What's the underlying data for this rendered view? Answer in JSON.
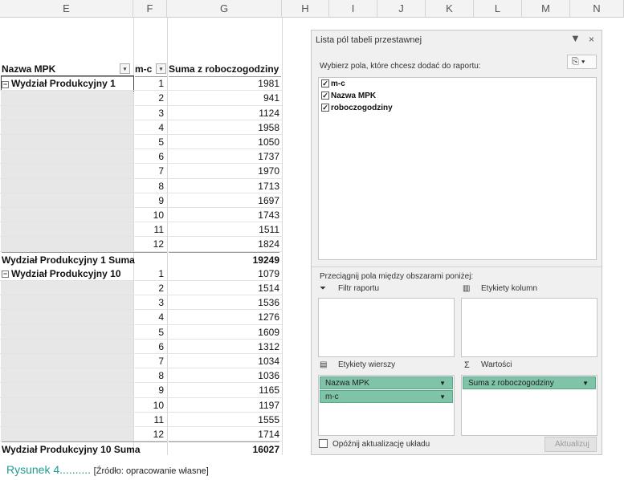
{
  "columns": [
    "E",
    "F",
    "G",
    "H",
    "I",
    "J",
    "K",
    "L",
    "M",
    "N"
  ],
  "pivot": {
    "header_name": "Nazwa MPK",
    "header_mc": "m-c",
    "header_sum": "Suma z roboczogodziny",
    "groups": [
      {
        "label": "Wydział Produkcyjny 1",
        "rows": [
          [
            "1",
            "1981"
          ],
          [
            "2",
            "941"
          ],
          [
            "3",
            "1124"
          ],
          [
            "4",
            "1958"
          ],
          [
            "5",
            "1050"
          ],
          [
            "6",
            "1737"
          ],
          [
            "7",
            "1970"
          ],
          [
            "8",
            "1713"
          ],
          [
            "9",
            "1697"
          ],
          [
            "10",
            "1743"
          ],
          [
            "11",
            "1511"
          ],
          [
            "12",
            "1824"
          ]
        ],
        "total_label": "Wydział Produkcyjny 1 Suma",
        "total_value": "19249"
      },
      {
        "label": "Wydział Produkcyjny 10",
        "rows": [
          [
            "1",
            "1079"
          ],
          [
            "2",
            "1514"
          ],
          [
            "3",
            "1536"
          ],
          [
            "4",
            "1276"
          ],
          [
            "5",
            "1609"
          ],
          [
            "6",
            "1312"
          ],
          [
            "7",
            "1034"
          ],
          [
            "8",
            "1036"
          ],
          [
            "9",
            "1165"
          ],
          [
            "10",
            "1197"
          ],
          [
            "11",
            "1555"
          ],
          [
            "12",
            "1714"
          ]
        ],
        "total_label": "Wydział Produkcyjny 10 Suma",
        "total_value": "16027"
      }
    ]
  },
  "panel": {
    "title": "Lista pól tabeli przestawnej",
    "close": "×",
    "choose_label": "Wybierz pola, które chcesz dodać do raportu:",
    "fields": [
      "m-c",
      "Nazwa MPK",
      "roboczogodziny"
    ],
    "drag_label": "Przeciągnij pola między obszarami poniżej:",
    "area_filter": "Filtr raportu",
    "area_columns": "Etykiety kolumn",
    "area_rows": "Etykiety wierszy",
    "area_values": "Wartości",
    "row_pills": [
      "Nazwa MPK",
      "m-c"
    ],
    "value_pills": [
      "Suma z roboczogodziny"
    ],
    "defer_label": "Opóźnij aktualizację układu",
    "update_button": "Aktualizuj"
  },
  "caption": {
    "title": "Rysunek 4..........",
    "source": "[Źródło: opracowanie własne]"
  },
  "colors": {
    "accent_green": "#7fc4a8",
    "caption_green": "#1f9d8f"
  }
}
